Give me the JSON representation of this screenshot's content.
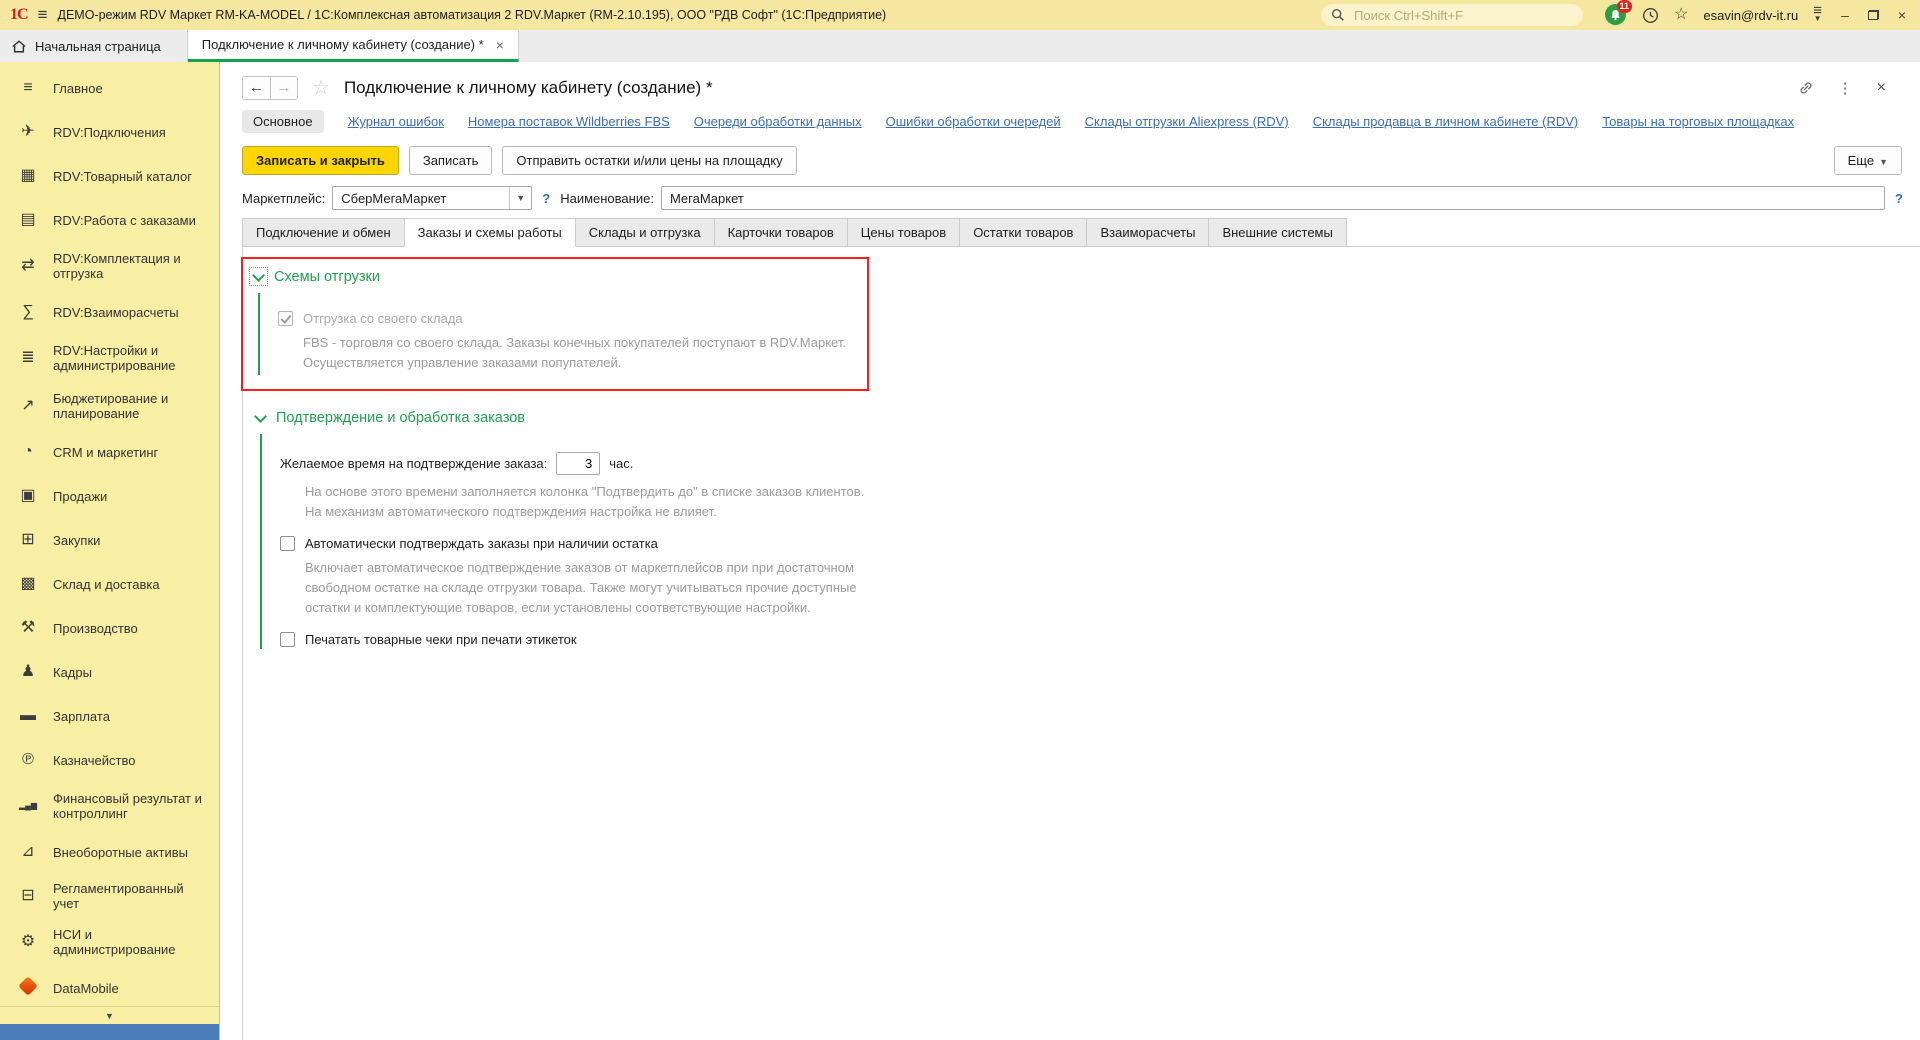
{
  "titlebar": {
    "logo": "1С",
    "app_title": "ДЕМО-режим RDV Маркет RM-KA-MODEL / 1С:Комплексная автоматизация 2 RDV.Маркет (RM-2.10.195), ООО \"РДВ Софт\"  (1С:Предприятие)",
    "search_placeholder": "Поиск Ctrl+Shift+F",
    "notification_count": "11",
    "user_email": "esavin@rdv-it.ru"
  },
  "window_tabs": {
    "home_label": "Начальная страница",
    "active_label": "Подключение к личному кабинету (создание) *",
    "close_glyph": "✕"
  },
  "sidebar": {
    "scroll_down_glyph": "▼",
    "items": [
      {
        "id": "glavnoe",
        "icon": "menu-icon",
        "glyph": "≡",
        "label": "Главное",
        "two_line": false
      },
      {
        "id": "rdv-podklyucheniya",
        "icon": "rocket-icon",
        "glyph": "✈",
        "label": "RDV:Подключения",
        "two_line": false
      },
      {
        "id": "rdv-tovarny-katalog",
        "icon": "catalog-grid-icon",
        "glyph": "▦",
        "label": "RDV:Товарный каталог",
        "two_line": false
      },
      {
        "id": "rdv-rabota-s-zakazami",
        "icon": "order-document-icon",
        "glyph": "▤",
        "label": "RDV:Работа с заказами",
        "two_line": false
      },
      {
        "id": "rdv-komplektaciya",
        "icon": "handtruck-icon",
        "glyph": "⇄",
        "label": "RDV:Комплектация и отгрузка",
        "two_line": true
      },
      {
        "id": "rdv-vzaimoraschety",
        "icon": "calculator-icon",
        "glyph": "∑",
        "label": "RDV:Взаиморасчеты",
        "two_line": false
      },
      {
        "id": "rdv-nastroyki",
        "icon": "sliders-icon",
        "glyph": "≣",
        "label": "RDV:Настройки и администрирование",
        "two_line": true
      },
      {
        "id": "byudzhetirovanie",
        "icon": "planning-chart-icon",
        "glyph": "↗",
        "label": "Бюджетирование и планирование",
        "two_line": true
      },
      {
        "id": "crm-marketing",
        "icon": "pie-chart-icon",
        "glyph": "◔",
        "label": "CRM и маркетинг",
        "two_line": false
      },
      {
        "id": "prodazhi",
        "icon": "briefcase-icon",
        "glyph": "▣",
        "label": "Продажи",
        "two_line": false
      },
      {
        "id": "zakupki",
        "icon": "cart-icon",
        "glyph": "⊞",
        "label": "Закупки",
        "two_line": false
      },
      {
        "id": "sklad-dostavka",
        "icon": "warehouse-grid-icon",
        "glyph": "▩",
        "label": "Склад и доставка",
        "two_line": false
      },
      {
        "id": "proizvodstvo",
        "icon": "factory-icon",
        "glyph": "⚒",
        "label": "Производство",
        "two_line": false
      },
      {
        "id": "kadry",
        "icon": "person-icon",
        "glyph": "♟",
        "label": "Кадры",
        "two_line": false
      },
      {
        "id": "zarplata",
        "icon": "card-icon",
        "glyph": "▬",
        "label": "Зарплата",
        "two_line": false
      },
      {
        "id": "kaznacheystvo",
        "icon": "ruble-circle-icon",
        "glyph": "℗",
        "label": "Казначейство",
        "two_line": false
      },
      {
        "id": "finrezultat",
        "icon": "bar-chart-icon",
        "glyph": "▂▄▆",
        "label": "Финансовый результат и контроллинг",
        "two_line": true
      },
      {
        "id": "vneoborotnye-aktivy",
        "icon": "truck-icon",
        "glyph": "⊿",
        "label": "Внеоборотные активы",
        "two_line": false
      },
      {
        "id": "reglament-uchet",
        "icon": "register-icon",
        "glyph": "⊟",
        "label": "Регламентированный учет",
        "two_line": false
      },
      {
        "id": "nsi-administrirovanie",
        "icon": "gear-icon",
        "glyph": "⚙",
        "label": "НСИ и администрирование",
        "two_line": true
      },
      {
        "id": "datamobile",
        "icon": "datamobile-logo-icon",
        "glyph": "",
        "label": "DataMobile",
        "two_line": false
      }
    ]
  },
  "header": {
    "back_glyph": "←",
    "forward_glyph": "→",
    "page_title": "Подключение к личному кабинету (создание) *",
    "kebab_glyph": "⋮",
    "close_glyph": "✕"
  },
  "nav": {
    "active": "Основное",
    "links": [
      "Журнал ошибок",
      "Номера поставок Wildberries FBS",
      "Очереди обработки данных",
      "Ошибки обработки очередей",
      "Склады отгрузки Aliexpress (RDV)",
      "Склады продавца в личном кабинете (RDV)",
      "Товары на торговых площадках"
    ]
  },
  "toolbar": {
    "save_close_label": "Записать и закрыть",
    "save_label": "Записать",
    "send_label": "Отправить остатки и/или цены на площадку",
    "more_label": "Еще",
    "more_caret": "▼"
  },
  "fields": {
    "marketplace_label": "Маркетплейс:",
    "marketplace_value": "СберМегаМаркет",
    "combo_caret": "▼",
    "help_glyph": "?",
    "name_label": "Наименование:",
    "name_value": "МегаМаркет"
  },
  "form_tabs": {
    "active_index": 1,
    "items": [
      "Подключение и обмен",
      "Заказы и схемы работы",
      "Склады и отгрузка",
      "Карточки товаров",
      "Цены товаров",
      "Остатки товаров",
      "Взаиморасчеты",
      "Внешние системы"
    ]
  },
  "groups": {
    "shipping": {
      "title": "Схемы отгрузки",
      "own_warehouse_label": "Отгрузка со своего склада",
      "own_warehouse_hint1": "FBS - торговля со своего склада. Заказы конечных покупателей поступают в RDV.Маркет.",
      "own_warehouse_hint2": "Осуществляется управление заказами попупателей."
    },
    "confirmation": {
      "title": "Подтверждение и обработка заказов",
      "time_label": "Желаемое время на подтверждение заказа:",
      "time_value": "3",
      "time_unit": "час.",
      "time_hint1": "На основе этого времени заполняется колонка \"Подтвердить до\" в списке заказов клиентов.",
      "time_hint2": "На механизм автоматического подтверждения настройка не влияет.",
      "auto_confirm_label": "Автоматически подтверждать заказы при наличии остатка",
      "auto_confirm_hint1": "Включает автоматическое подтверждение заказов от маркетплейсов при при достаточном",
      "auto_confirm_hint2": "свободном остатке на складе отгрузки товара. Также могут учитываться прочие доступные",
      "auto_confirm_hint3": "остатки и комплектующие товаров, если установлены соответствующие настройки.",
      "print_receipts_label": "Печатать товарные чеки при печати этикеток"
    }
  },
  "colors": {
    "accent_green": "#17a24f",
    "link_blue": "#3a6db5",
    "primary_yellow": "#fdd600",
    "highlight_red": "#fb1f1f",
    "panel_yellow": "#f8efa4"
  }
}
